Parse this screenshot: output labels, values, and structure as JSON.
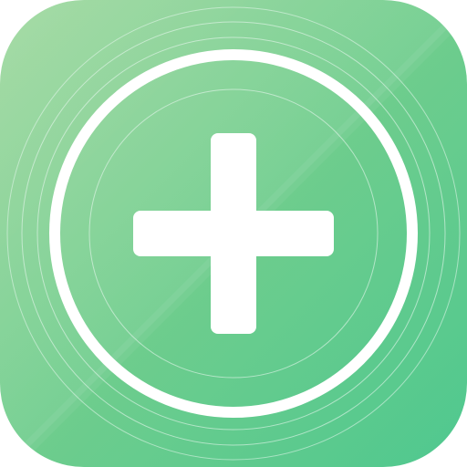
{
  "icon": {
    "name": "add-plus-icon",
    "colors": {
      "background_light": "#9bd69a",
      "background_mid": "#6fcd8d",
      "background_dark": "#4fc88f",
      "symbol": "#ffffff",
      "ring_thin": "#e8f7ee"
    }
  }
}
